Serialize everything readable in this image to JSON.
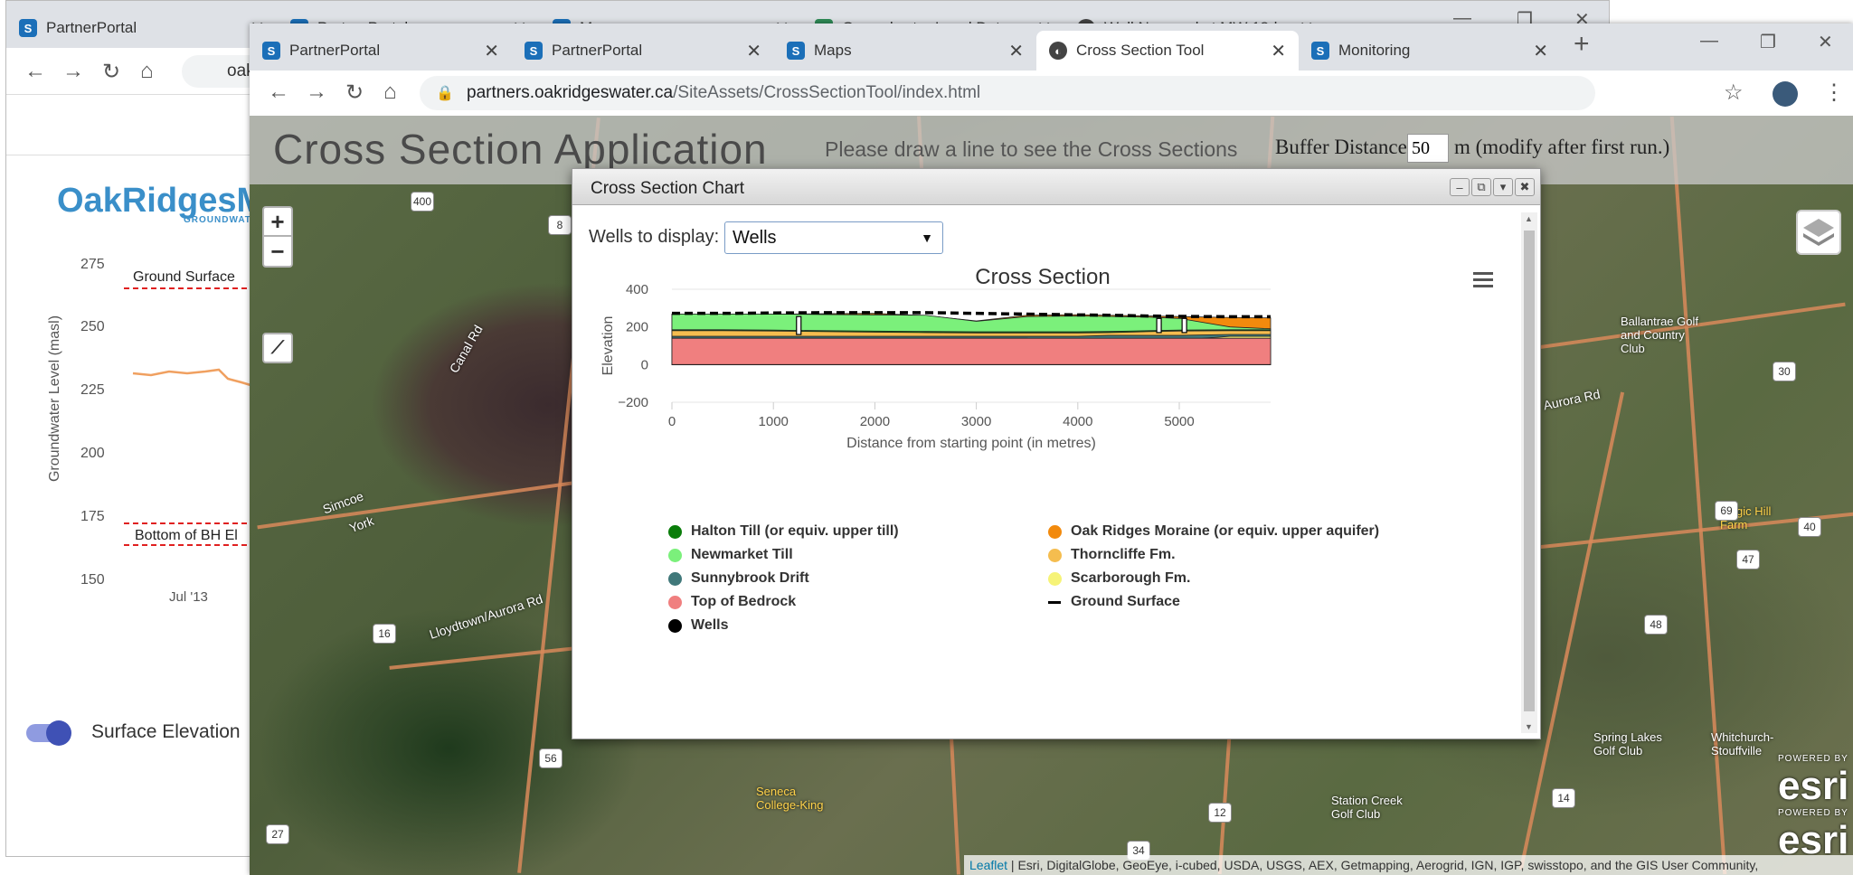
{
  "back_window": {
    "tabs": [
      {
        "label": "PartnerPortal"
      },
      {
        "label": "PartnerPortal"
      },
      {
        "label": "Maps"
      },
      {
        "label": "Groundwater Level Data"
      },
      {
        "label": "Well Newmarket MW 18d"
      }
    ],
    "url_partial": "oak",
    "logo_text": "OakRidgesMo",
    "logo_sub": "GROUNDWATE",
    "chart": {
      "ylabel": "Groundwater Level (masl)",
      "yticks": [
        "275",
        "250",
        "225",
        "200",
        "175",
        "150"
      ],
      "xtick": "Jul '13",
      "ground_surface_label": "Ground Surface",
      "bottom_label": "Bottom of BH El"
    },
    "toggle_label": "Surface Elevation"
  },
  "front_window": {
    "tabs": [
      {
        "label": "PartnerPortal"
      },
      {
        "label": "PartnerPortal"
      },
      {
        "label": "Maps"
      },
      {
        "label": "Cross Section Tool"
      },
      {
        "label": "Monitoring"
      }
    ],
    "url_host": "partners.oakridgeswater.ca",
    "url_path": "/SiteAssets/CrossSectionTool/index.html"
  },
  "app": {
    "title": "Cross Section Application",
    "instruction": "Please draw a line to see the Cross Sections",
    "buffer_label": "Buffer Distance",
    "buffer_value": "50",
    "buffer_note": "m (modify after first run.)",
    "zoom_in": "+",
    "zoom_out": "−",
    "attribution_link": "Leaflet",
    "attribution_text": " | Esri, DigitalGlobe, GeoEye, i-cubed, USDA, USGS, AEX, Getmapping, Aerogrid, IGN, IGP, swisstopo, and the GIS User Community,"
  },
  "map_labels": {
    "simcoe": "Simcoe",
    "york": "York",
    "canal_rd": "Canal Rd",
    "lloydtown": "Lloydtown/Aurora Rd",
    "ballantrae": "Ballantrae Golf and Country Club",
    "aurora_rd": "Aurora Rd",
    "magic_hill": "Magic Hill Farm",
    "spring_lakes": "Spring Lakes Golf Club",
    "whitchurch": "Whitchurch-Stouffville",
    "station_creek": "Station Creek Golf Club",
    "seneca": "Seneca College-King",
    "esri": "esri",
    "powered_by": "POWERED BY",
    "shields": [
      "400",
      "8",
      "16",
      "56",
      "27",
      "34",
      "12",
      "14",
      "47",
      "48",
      "40",
      "69",
      "30"
    ]
  },
  "dialog": {
    "title": "Cross Section Chart",
    "wells_label": "Wells to display:",
    "wells_value": "Wells"
  },
  "chart_data": {
    "type": "area",
    "title": "Cross Section",
    "xlabel": "Distance from starting point (in metres)",
    "ylabel": "Elevation",
    "xlim": [
      0,
      5900
    ],
    "ylim": [
      -200,
      400
    ],
    "xticks": [
      0,
      1000,
      2000,
      3000,
      4000,
      5000
    ],
    "yticks": [
      400,
      200,
      0,
      -200
    ],
    "x": [
      0,
      500,
      1000,
      1500,
      2000,
      2500,
      3000,
      3500,
      4000,
      4300,
      4500,
      4700,
      5000,
      5500,
      5900
    ],
    "series": [
      {
        "name": "Top of Bedrock",
        "color": "#f07f7f",
        "values": [
          140,
          140,
          140,
          140,
          140,
          140,
          140,
          140,
          140,
          140,
          140,
          140,
          140,
          140,
          140
        ]
      },
      {
        "name": "Scarborough Fm.",
        "color": "#f6f377",
        "values": [
          140,
          140,
          140,
          140,
          140,
          140,
          140,
          140,
          80,
          30,
          20,
          40,
          130,
          150,
          150
        ]
      },
      {
        "name": "Sunnybrook Drift",
        "color": "#40787a",
        "values": [
          150,
          150,
          150,
          150,
          150,
          150,
          150,
          150,
          150,
          155,
          155,
          155,
          155,
          160,
          160
        ]
      },
      {
        "name": "Thorncliffe Fm.",
        "color": "#f5bd4f",
        "values": [
          180,
          180,
          178,
          175,
          172,
          170,
          168,
          168,
          168,
          170,
          172,
          175,
          178,
          180,
          180
        ]
      },
      {
        "name": "Halton Till (or equiv. upper till)",
        "color": "#0a7d0a",
        "values": [
          185,
          185,
          183,
          180,
          178,
          176,
          174,
          174,
          174,
          176,
          178,
          180,
          183,
          185,
          185
        ]
      },
      {
        "name": "Newmarket Till",
        "color": "#7bf07b",
        "values": [
          268,
          268,
          268,
          266,
          264,
          262,
          230,
          255,
          258,
          256,
          254,
          252,
          245,
          200,
          190
        ]
      },
      {
        "name": "Oak Ridges Moraine (or equiv. upper aquifer)",
        "color": "#f28a0d",
        "values": [
          268,
          268,
          268,
          270,
          272,
          260,
          232,
          262,
          265,
          262,
          260,
          258,
          255,
          250,
          248
        ]
      },
      {
        "name": "Ground Surface",
        "color": "#000000",
        "values": [
          272,
          272,
          274,
          276,
          276,
          276,
          272,
          268,
          264,
          262,
          260,
          258,
          256,
          254,
          254
        ]
      }
    ],
    "wells": {
      "name": "Wells",
      "color": "#000000",
      "x": [
        1250,
        4800,
        5050
      ],
      "top": [
        255,
        245,
        245
      ],
      "bottom": [
        160,
        170,
        170
      ]
    },
    "legend": [
      {
        "name": "Halton Till (or equiv. upper till)",
        "color": "#0a7d0a",
        "shape": "dot"
      },
      {
        "name": "Oak Ridges Moraine (or equiv. upper aquifer)",
        "color": "#f28a0d",
        "shape": "dot"
      },
      {
        "name": "Newmarket Till",
        "color": "#7bf07b",
        "shape": "dot"
      },
      {
        "name": "Thorncliffe Fm.",
        "color": "#f5bd4f",
        "shape": "dot"
      },
      {
        "name": "Sunnybrook Drift",
        "color": "#40787a",
        "shape": "dot"
      },
      {
        "name": "Scarborough Fm.",
        "color": "#f6f377",
        "shape": "dot"
      },
      {
        "name": "Top of Bedrock",
        "color": "#f07f7f",
        "shape": "dot"
      },
      {
        "name": "Ground Surface",
        "color": "#000000",
        "shape": "dash"
      },
      {
        "name": "Wells",
        "color": "#000000",
        "shape": "dot"
      }
    ]
  }
}
